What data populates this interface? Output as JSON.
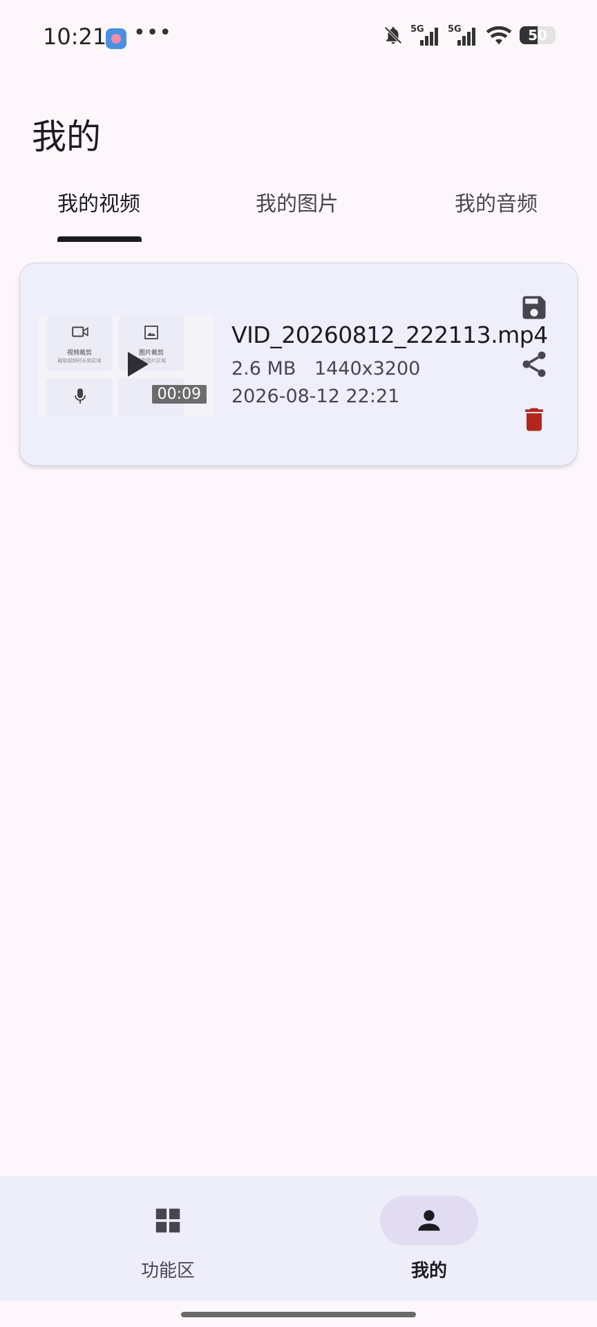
{
  "status_bar": {
    "time": "10:21",
    "more": "•••",
    "signal_1_label": "5G",
    "signal_2_label": "5G",
    "battery_level": 50,
    "battery_text": "50",
    "icons": [
      "app-notification-icon",
      "more-icon",
      "bell-off-icon",
      "signal-5g-icon",
      "signal-5g-icon",
      "wifi-icon",
      "battery-icon"
    ]
  },
  "page": {
    "title": "我的"
  },
  "tabs": [
    {
      "label": "我的视频",
      "active": true
    },
    {
      "label": "我的图片",
      "active": false
    },
    {
      "label": "我的音频",
      "active": false
    }
  ],
  "media_card": {
    "file_name": "VID_20260812_222113.mp4",
    "size": "2.6 MB",
    "resolution": "1440x3200",
    "date": "2026-08-12 22:21",
    "duration": "00:09",
    "thumb_tiles": [
      {
        "title": "视频裁剪",
        "subtitle": "截取视频时长和区域"
      },
      {
        "title": "图片裁剪",
        "subtitle": "截取图片区域"
      }
    ],
    "actions": [
      "save-icon",
      "share-icon",
      "delete-icon"
    ]
  },
  "bottom_nav": {
    "items": [
      {
        "label": "功能区",
        "icon": "grid-icon",
        "active": false
      },
      {
        "label": "我的",
        "icon": "person-icon",
        "active": true
      }
    ]
  },
  "colors": {
    "background": "#FDF7FB",
    "card": "#EEEFFB",
    "delete": "#B3261E",
    "nav_active_pill": "#E2DCF3",
    "icon_dark": "#49454F"
  }
}
